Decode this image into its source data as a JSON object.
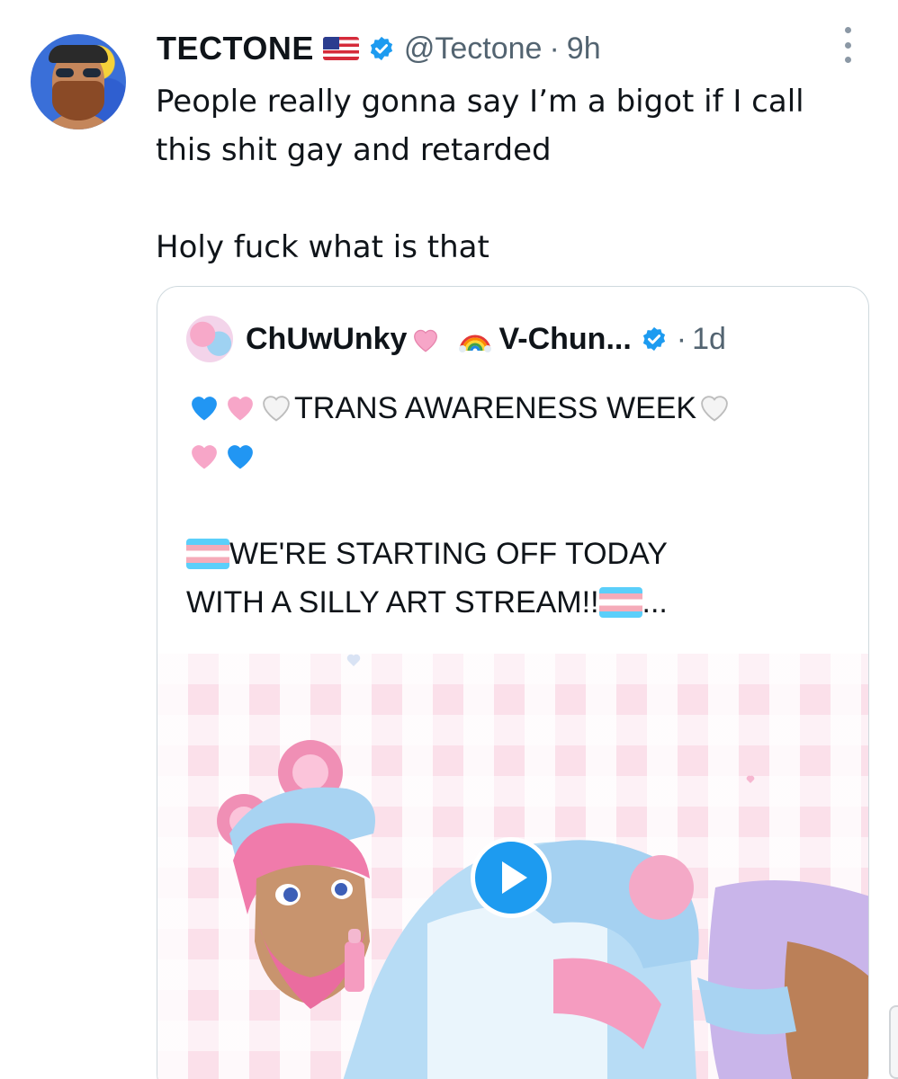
{
  "tweet": {
    "author_name": "TECTONE",
    "flag_icon": "us-flag-icon",
    "verified_icon": "verified-badge-icon",
    "handle": "@Tectone",
    "separator": "·",
    "time": "9h",
    "lines": [
      "People really gonna say I’m a bigot if I call",
      "this shit gay and retarded",
      "",
      "Holy fuck what is that"
    ]
  },
  "quote": {
    "author_name": "ChUwUnky",
    "author_name_2": "V-Chun...",
    "separator": "·",
    "time": "1d",
    "line1_text": "TRANS AWARENESS WEEK",
    "line3_text": "WE'RE STARTING OFF TODAY",
    "line4_text": "WITH A SILLY ART STREAM!!",
    "line4_suffix": "...",
    "media_type": "video",
    "play_icon": "play-icon"
  },
  "colors": {
    "verified_blue": "#1d9bf0",
    "muted_text": "#536471",
    "border": "#cfd9de",
    "media_pink": "#fbe0ea"
  }
}
